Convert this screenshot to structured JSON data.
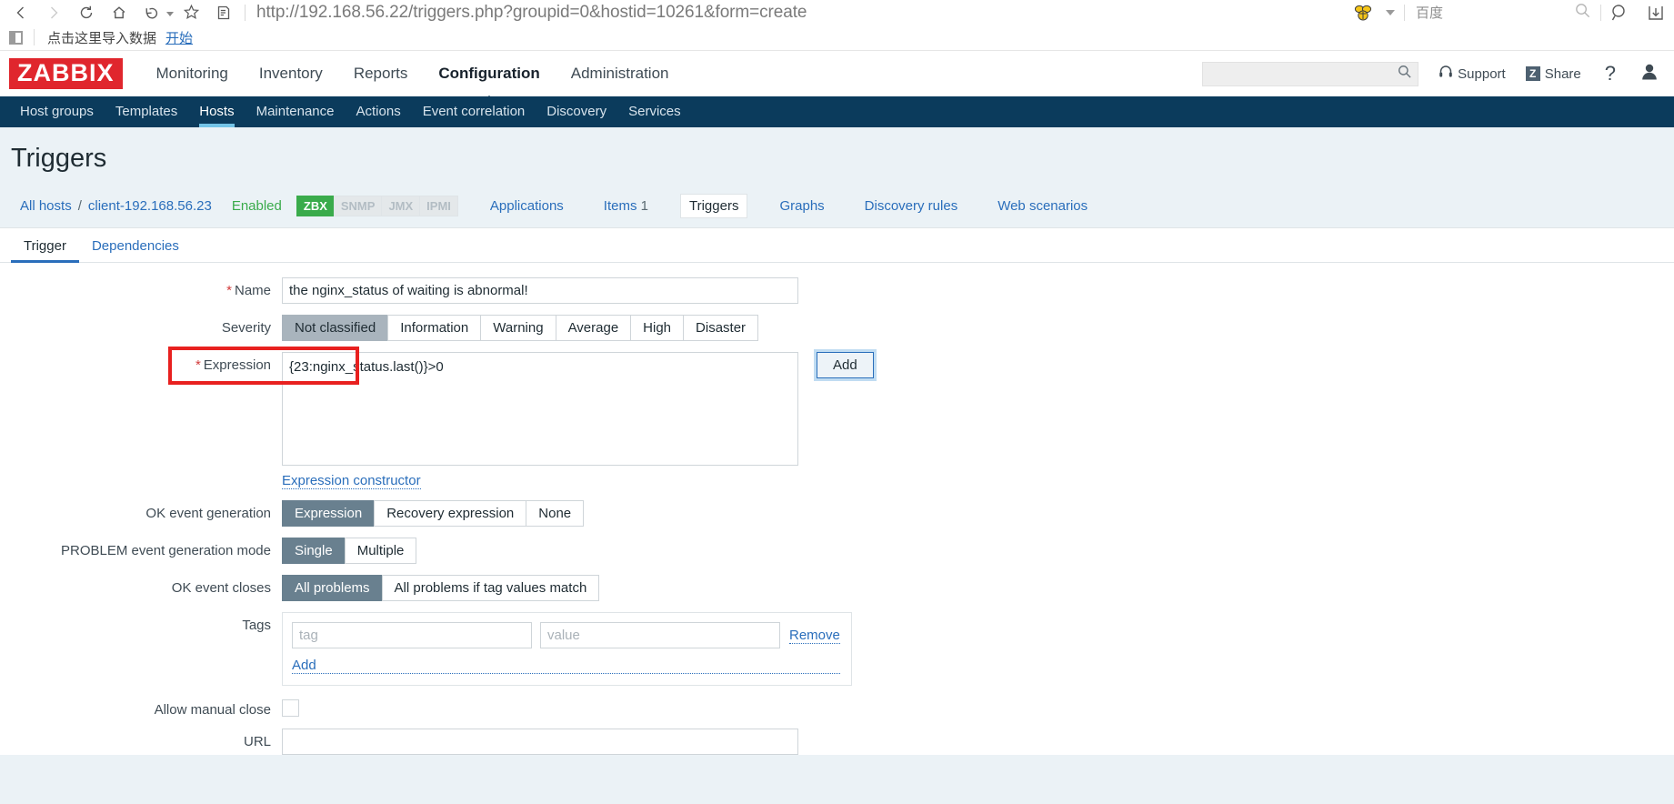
{
  "browser": {
    "url": "http://192.168.56.22/triggers.php?groupid=0&hostid=10261&form=create",
    "nav": {
      "back": "back-icon",
      "forward": "forward-icon",
      "reload": "reload-icon",
      "home": "home-icon",
      "undo": "undo-icon",
      "bookmark_star": "star-icon",
      "reader": "reader-icon"
    },
    "search_engine": {
      "name": "百度",
      "icon": "bee-icon"
    },
    "bookmarks": {
      "text": "点击这里导入数据",
      "link": "开始"
    }
  },
  "header": {
    "logo": "ZABBIX",
    "logo_color": "#e0262d",
    "nav": [
      {
        "label": "Monitoring",
        "active": false
      },
      {
        "label": "Inventory",
        "active": false
      },
      {
        "label": "Reports",
        "active": false
      },
      {
        "label": "Configuration",
        "active": true
      },
      {
        "label": "Administration",
        "active": false
      }
    ],
    "search_placeholder": "",
    "search_value": "",
    "support_label": "Support",
    "share_label": "Share",
    "share_badge": "Z",
    "help_label": "?"
  },
  "subnav": {
    "accent": "#73c3e6",
    "background": "#0b3b5c",
    "items": [
      {
        "label": "Host groups",
        "active": false
      },
      {
        "label": "Templates",
        "active": false
      },
      {
        "label": "Hosts",
        "active": true
      },
      {
        "label": "Maintenance",
        "active": false
      },
      {
        "label": "Actions",
        "active": false
      },
      {
        "label": "Event correlation",
        "active": false
      },
      {
        "label": "Discovery",
        "active": false
      },
      {
        "label": "Services",
        "active": false
      }
    ]
  },
  "page": {
    "title": "Triggers"
  },
  "breadcrumb": {
    "all_hosts": "All hosts",
    "separator": "/",
    "host": "client-192.168.56.23",
    "status": "Enabled",
    "status_color": "#3aab4b",
    "protocols": [
      {
        "label": "ZBX",
        "enabled": true
      },
      {
        "label": "SNMP",
        "enabled": false
      },
      {
        "label": "JMX",
        "enabled": false
      },
      {
        "label": "IPMI",
        "enabled": false
      }
    ],
    "tabs": [
      {
        "label": "Applications",
        "count": "",
        "selected": false
      },
      {
        "label": "Items",
        "count": "1",
        "selected": false
      },
      {
        "label": "Triggers",
        "count": "",
        "selected": true
      },
      {
        "label": "Graphs",
        "count": "",
        "selected": false
      },
      {
        "label": "Discovery rules",
        "count": "",
        "selected": false
      },
      {
        "label": "Web scenarios",
        "count": "",
        "selected": false
      }
    ]
  },
  "form": {
    "tabs": [
      {
        "label": "Trigger",
        "active": true
      },
      {
        "label": "Dependencies",
        "active": false
      }
    ],
    "name": {
      "label": "Name",
      "required": true,
      "value": "the nginx_status of waiting is abnormal!",
      "placeholder": ""
    },
    "severity": {
      "label": "Severity",
      "options": [
        {
          "label": "Not classified",
          "selected": true
        },
        {
          "label": "Information",
          "selected": false
        },
        {
          "label": "Warning",
          "selected": false
        },
        {
          "label": "Average",
          "selected": false
        },
        {
          "label": "High",
          "selected": false
        },
        {
          "label": "Disaster",
          "selected": false
        }
      ]
    },
    "expression": {
      "label": "Expression",
      "required": true,
      "value": "{23:nginx_status.last()}>0",
      "add_button": "Add",
      "constructor_link": "Expression constructor",
      "annotation_color": "#e8201f"
    },
    "ok_event_generation": {
      "label": "OK event generation",
      "options": [
        {
          "label": "Expression",
          "selected": true
        },
        {
          "label": "Recovery expression",
          "selected": false
        },
        {
          "label": "None",
          "selected": false
        }
      ]
    },
    "problem_event_mode": {
      "label": "PROBLEM event generation mode",
      "options": [
        {
          "label": "Single",
          "selected": true
        },
        {
          "label": "Multiple",
          "selected": false
        }
      ]
    },
    "ok_event_closes": {
      "label": "OK event closes",
      "options": [
        {
          "label": "All problems",
          "selected": true
        },
        {
          "label": "All problems if tag values match",
          "selected": false
        }
      ]
    },
    "tags": {
      "label": "Tags",
      "tag_placeholder": "tag",
      "tag_value": "",
      "value_placeholder": "value",
      "value_value": "",
      "remove_label": "Remove",
      "add_label": "Add"
    },
    "allow_manual_close": {
      "label": "Allow manual close",
      "checked": false
    },
    "url": {
      "label": "URL",
      "value": "",
      "placeholder": ""
    }
  }
}
